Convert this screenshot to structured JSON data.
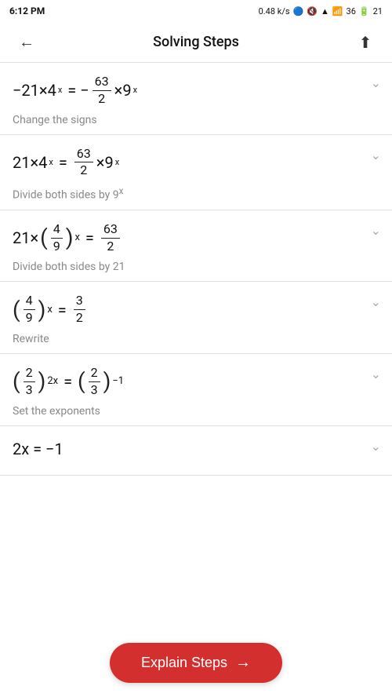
{
  "status": {
    "time": "6:12 PM",
    "signal_icons": "∞ ⓘ 🔔 📷 ···",
    "speed": "0.48 k/s",
    "battery": "21"
  },
  "header": {
    "back_label": "←",
    "title": "Solving Steps",
    "share_label": "⬆"
  },
  "steps": [
    {
      "id": 1,
      "description": "Change the signs"
    },
    {
      "id": 2,
      "description": "Divide both sides by 9ˣ"
    },
    {
      "id": 3,
      "description": "Divide both sides by 21"
    },
    {
      "id": 4,
      "description": "Rewrite"
    },
    {
      "id": 5,
      "description": "Set the exponents"
    },
    {
      "id": 6,
      "description": ""
    }
  ],
  "explain_button": {
    "label": "Explain Steps",
    "arrow": "→"
  }
}
